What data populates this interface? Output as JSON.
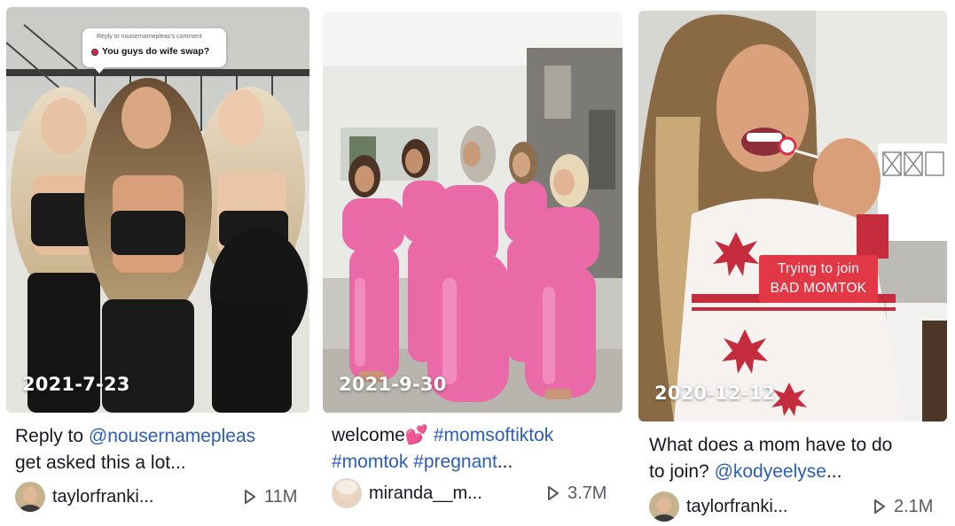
{
  "videos": [
    {
      "date": "2021-7-23",
      "reply_bubble": {
        "reply_to": "Reply to nousernamepleas's comment",
        "text": "You guys do wife swap?"
      },
      "caption": {
        "prefix": "Reply to ",
        "mention": "@nousernamepleas",
        "line2": "get asked this a lot..."
      },
      "author": "taylorfranki...",
      "views": "11M"
    },
    {
      "date": "2021-9-30",
      "caption": {
        "prefix": "welcome",
        "emoji": "💕",
        "tag1": "#momsoftiktok",
        "tag2": "#momtok",
        "tag3": "#pregnant",
        "suffix": "..."
      },
      "author": "miranda__m...",
      "views": "3.7M"
    },
    {
      "date": "2020-12-12",
      "sticker": {
        "line1": "Trying to join",
        "line2": "BAD MOMTOK"
      },
      "caption": {
        "line1": "What does a mom have to do",
        "prefix": "to join? ",
        "mention": "@kodyeelyse",
        "suffix": "..."
      },
      "author": "taylorfranki...",
      "views": "2.1M"
    }
  ],
  "colors": {
    "mention": "#2b5db9",
    "sticker_bg": "#e23845",
    "pink_outfit": "#e96aa7"
  },
  "icons": {
    "play": "play-icon"
  }
}
